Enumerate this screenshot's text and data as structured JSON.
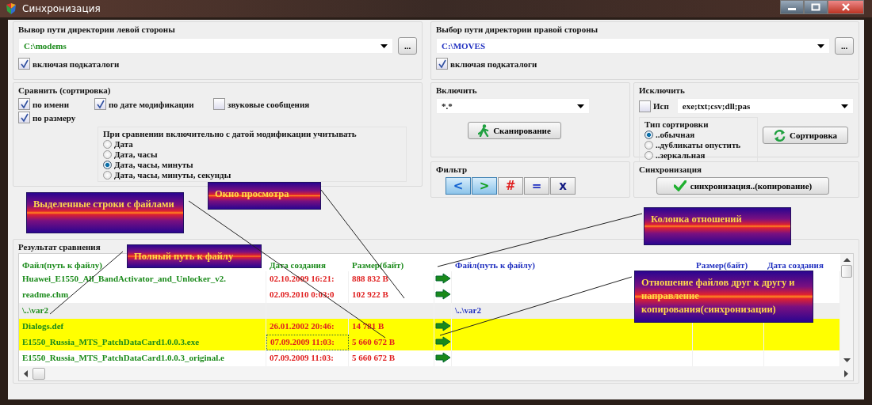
{
  "window": {
    "title": "Синхронизация"
  },
  "left_dir": {
    "label": "Вывор пути директории левой стороны",
    "path": "C:\\modems",
    "browse": "...",
    "subdirs": {
      "label": "включая подкаталоги",
      "checked": true
    }
  },
  "right_dir": {
    "label": "Выбор пути директории правой стороны",
    "path": "C:\\MOVES",
    "browse": "...",
    "subdirs": {
      "label": "включая подкаталоги",
      "checked": true
    }
  },
  "compare": {
    "label": "Сравнить (сортировка)",
    "options": [
      {
        "label": "по имени",
        "checked": true
      },
      {
        "label": "по дате модификации",
        "checked": true
      },
      {
        "label": "звуковые сообщения",
        "checked": false
      },
      {
        "label": "по размеру",
        "checked": true
      }
    ],
    "precision": {
      "label": "При сравнении включительно с датой модификации  учитывать",
      "options": [
        {
          "label": "Дата",
          "selected": false
        },
        {
          "label": "Дата, часы",
          "selected": false
        },
        {
          "label": "Дата, часы, минуты",
          "selected": true
        },
        {
          "label": "Дата, часы, минуты, секунды",
          "selected": false
        }
      ]
    }
  },
  "include": {
    "label": "Включить",
    "mask": "*.*",
    "scan_button": "Сканирование"
  },
  "exclude": {
    "label": "Исключить",
    "use": {
      "label": "Исп",
      "checked": false
    },
    "mask": "exe;txt;csv;dll;pas",
    "sort_button": "Сортировка",
    "sort_type": {
      "label": "Тип сортировки",
      "options": [
        {
          "label": "..обычная",
          "selected": true
        },
        {
          "label": "..дубликаты опустить",
          "selected": false
        },
        {
          "label": "..зеркальная",
          "selected": false
        }
      ]
    }
  },
  "filter": {
    "label": "Фильтр",
    "buttons": [
      {
        "symbol": "<",
        "color": "#1060d0",
        "selected": true
      },
      {
        "symbol": ">",
        "color": "#10a020",
        "selected": true
      },
      {
        "symbol": "#",
        "color": "#e02020",
        "selected": false
      },
      {
        "symbol": "=",
        "color": "#2030c0",
        "selected": false
      },
      {
        "symbol": "x",
        "color": "#101880",
        "selected": false
      }
    ]
  },
  "sync": {
    "label": "Синхронизация",
    "button": "синхронизация..(копирование)"
  },
  "results": {
    "label": "Результат сравнения",
    "left_columns": [
      "Файл(путь к файлу)",
      "Дата создания",
      "Размер(байт)"
    ],
    "right_columns": [
      "Файл(путь к файлу)",
      "Размер(байт)",
      "Дата создания"
    ],
    "rows": [
      {
        "kind": "file",
        "left_name": "Huawei_E1550_All_BandActivator_and_Unlocker_v2.",
        "date": "02.10.2009 16:21:",
        "size": "888 832 B",
        "arrow": true,
        "selected": false,
        "focused": false
      },
      {
        "kind": "file",
        "left_name": "readme.chm",
        "date": "02.09.2010 0:03:0",
        "size": "102 922 B",
        "arrow": true,
        "selected": false,
        "focused": false
      },
      {
        "kind": "folder",
        "left_name": "\\..\\var2",
        "right_name": "\\..\\var2",
        "arrow": false,
        "selected": false,
        "focused": false
      },
      {
        "kind": "file",
        "left_name": "Dialogs.def",
        "date": "26.01.2002 20:46:",
        "size": "14 781 B",
        "arrow": true,
        "selected": true,
        "focused": false
      },
      {
        "kind": "file",
        "left_name": "E1550_Russia_MTS_PatchDataCard1.0.0.3.exe",
        "date": "07.09.2009 11:03:",
        "size": "5 660 672 B",
        "arrow": true,
        "selected": true,
        "focused": true
      },
      {
        "kind": "file",
        "left_name": "E1550_Russia_MTS_PatchDataCard1.0.0.3_original.e",
        "date": "07.09.2009 11:03:",
        "size": "5 660 672 B",
        "arrow": true,
        "selected": false,
        "focused": false
      }
    ]
  },
  "callouts": [
    {
      "text": "Выделенные строки с файлами"
    },
    {
      "text": "Окно просмотра"
    },
    {
      "text": "Полный путь к файлу"
    },
    {
      "text": "Колонка отношений"
    },
    {
      "text": "Отношение файлов друг к другу и направление копирования(синхронизации)"
    }
  ]
}
